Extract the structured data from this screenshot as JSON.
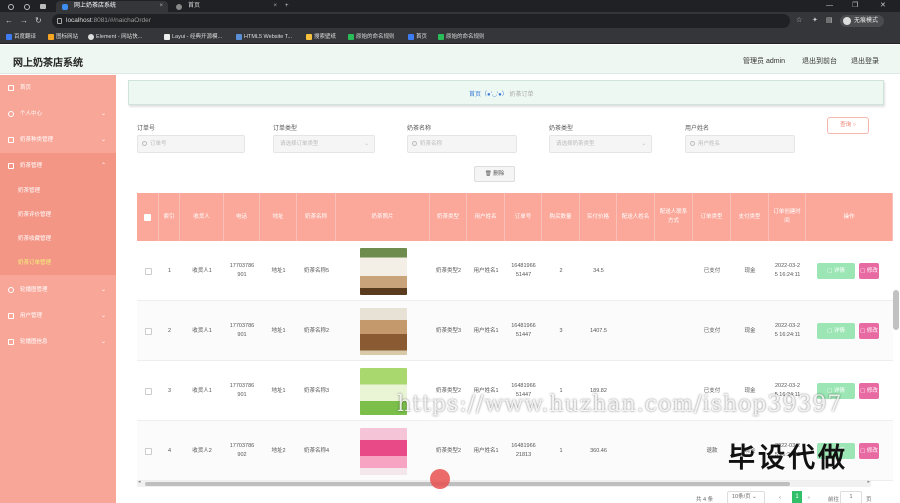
{
  "browser": {
    "tabs": [
      {
        "label": "网上奶茶店系统",
        "active": true
      },
      {
        "label": "首页",
        "active": false
      }
    ],
    "url_host": "localhost",
    "url_path": ":8081/#/naichaOrder",
    "profile": "无痕模式",
    "bookmarks": [
      "百度翻译",
      "图标网站",
      "Element - 网站快...",
      "Layui - 经典开源模...",
      "HTML5 Website T...",
      "搜索壁纸",
      "原始的命名规则",
      "首页",
      "原始的命名规则"
    ]
  },
  "header": {
    "title": "网上奶茶店系统",
    "admin": "管理员 admin",
    "to_front": "退出到前台",
    "logout": "退出登录"
  },
  "sidebar": {
    "items": [
      {
        "label": "首页"
      },
      {
        "label": "个人中心"
      },
      {
        "label": "奶茶种类管理"
      },
      {
        "label": "奶茶管理"
      }
    ],
    "sub_items": [
      {
        "label": "奶茶管理",
        "active": false
      },
      {
        "label": "奶茶评价管理",
        "active": false
      },
      {
        "label": "奶茶收藏管理",
        "active": false
      },
      {
        "label": "奶茶订单管理",
        "active": true
      }
    ],
    "items_after": [
      {
        "label": "轮播图管理"
      },
      {
        "label": "用户管理"
      },
      {
        "label": "轮播图信息"
      }
    ]
  },
  "breadcrumb": {
    "home": "首页（●'◡'●）",
    "current": "奶茶订单"
  },
  "filters": [
    {
      "label": "订单号",
      "placeholder": "订单号",
      "type": "input"
    },
    {
      "label": "订单类型",
      "placeholder": "请选择订单类型",
      "type": "select"
    },
    {
      "label": "奶茶名称",
      "placeholder": "奶茶名称",
      "type": "input"
    },
    {
      "label": "奶茶类型",
      "placeholder": "请选择奶茶类型",
      "type": "select"
    },
    {
      "label": "用户姓名",
      "placeholder": "用户姓名",
      "type": "input"
    }
  ],
  "search_label": "查询",
  "delete_label": "删除",
  "table": {
    "headers": [
      "索引",
      "收货人",
      "电话",
      "地址",
      "奶茶名称",
      "奶茶照片",
      "奶茶类型",
      "用户姓名",
      "订单号",
      "购买数量",
      "实付价格",
      "配送人姓名",
      "配送人联系方式",
      "订单类型",
      "支付类型",
      "订单创建时间",
      "操作"
    ],
    "rows": [
      {
        "index": "1",
        "receiver": "收货人1",
        "phone": "17703786901",
        "address": "地址1",
        "tea_name": "奶茶名称5",
        "image": "cup-cream",
        "tea_type": "奶茶类型2",
        "user_name": "用户姓名1",
        "order_no": "1648196651447",
        "qty": "2",
        "price": "34.5",
        "courier": "",
        "courier_contact": "",
        "order_type": "已支付",
        "pay_type": "现金",
        "created": "2022-03-25 16:24:11"
      },
      {
        "index": "2",
        "receiver": "收货人1",
        "phone": "17703786901",
        "address": "地址1",
        "tea_name": "奶茶名称2",
        "image": "cup-caramel",
        "tea_type": "奶茶类型3",
        "user_name": "用户姓名1",
        "order_no": "1648196651447",
        "qty": "3",
        "price": "1407.5",
        "courier": "",
        "courier_contact": "",
        "order_type": "已支付",
        "pay_type": "现金",
        "created": "2022-03-25 16:24:11"
      },
      {
        "index": "3",
        "receiver": "收货人1",
        "phone": "17703786901",
        "address": "地址1",
        "tea_name": "奶茶名称3",
        "image": "cup-matcha",
        "tea_type": "奶茶类型2",
        "user_name": "用户姓名1",
        "order_no": "1648196651447",
        "qty": "1",
        "price": "189.82",
        "courier": "",
        "courier_contact": "",
        "order_type": "已支付",
        "pay_type": "现金",
        "created": "2022-03-25 16:24:11"
      },
      {
        "index": "4",
        "receiver": "收货人2",
        "phone": "17703786902",
        "address": "地址2",
        "tea_name": "奶茶名称4",
        "image": "cup-berry",
        "tea_type": "奶茶类型2",
        "user_name": "用户姓名1",
        "order_no": "1648196621813",
        "qty": "1",
        "price": "360.46",
        "courier": "",
        "courier_contact": "",
        "order_type": "退款",
        "pay_type": "现金",
        "created": "2022-03-25 16:24:11"
      }
    ],
    "detail_label": "详情",
    "edit_label": "修改"
  },
  "pagination": {
    "total": "共 4 条",
    "page_size": "10条/页",
    "current": "1",
    "goto": "前往",
    "goto_value": "1",
    "page_unit": "页"
  },
  "watermark": "https://www.huzhan.com/ishop39397",
  "brand_mark": "毕设代做",
  "colors": {
    "sidebar": "#f8a698",
    "table_header": "#fba89a",
    "detail_btn": "#9be6b4",
    "edit_btn": "#e86aa2",
    "pager_active": "#30c06a"
  }
}
